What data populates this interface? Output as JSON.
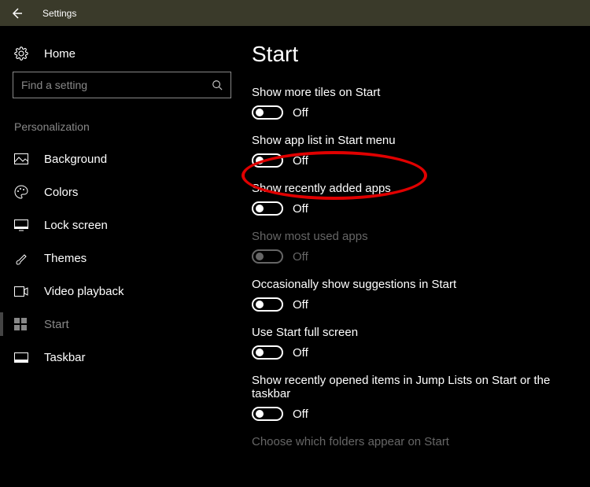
{
  "titlebar": {
    "title": "Settings"
  },
  "sidebar": {
    "home_label": "Home",
    "search_placeholder": "Find a setting",
    "section_header": "Personalization",
    "items": [
      {
        "label": "Background"
      },
      {
        "label": "Colors"
      },
      {
        "label": "Lock screen"
      },
      {
        "label": "Themes"
      },
      {
        "label": "Video playback"
      },
      {
        "label": "Start"
      },
      {
        "label": "Taskbar"
      }
    ]
  },
  "main": {
    "title": "Start",
    "settings": [
      {
        "label": "Show more tiles on Start",
        "state": "Off"
      },
      {
        "label": "Show app list in Start menu",
        "state": "Off"
      },
      {
        "label": "Show recently added apps",
        "state": "Off"
      },
      {
        "label": "Show most used apps",
        "state": "Off"
      },
      {
        "label": "Occasionally show suggestions in Start",
        "state": "Off"
      },
      {
        "label": "Use Start full screen",
        "state": "Off"
      },
      {
        "label": "Show recently opened items in Jump Lists on Start or the taskbar",
        "state": "Off"
      }
    ],
    "footer_link": "Choose which folders appear on Start"
  }
}
